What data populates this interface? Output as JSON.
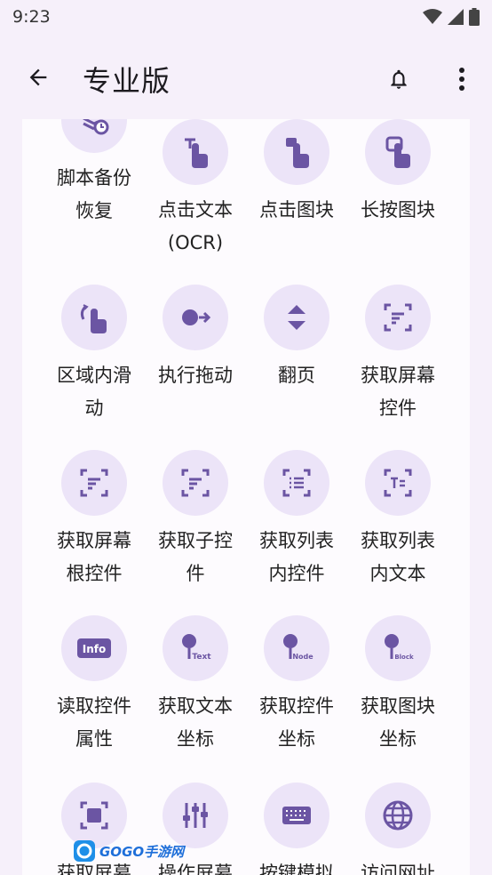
{
  "status": {
    "time": "9:23"
  },
  "appbar": {
    "title": "专业版"
  },
  "tiles": [
    {
      "label": "脚本备份恢复",
      "icon": "backup-restore-icon"
    },
    {
      "label": "点击文本(OCR)",
      "icon": "tap-text-icon"
    },
    {
      "label": "点击图块",
      "icon": "tap-image-icon"
    },
    {
      "label": "长按图块",
      "icon": "long-press-icon"
    },
    {
      "label": "区域内滑动",
      "icon": "swipe-area-icon"
    },
    {
      "label": "执行拖动",
      "icon": "drag-icon"
    },
    {
      "label": "翻页",
      "icon": "page-turn-icon"
    },
    {
      "label": "获取屏幕控件",
      "icon": "screen-widget-icon"
    },
    {
      "label": "获取屏幕根控件",
      "icon": "root-widget-icon"
    },
    {
      "label": "获取子控件",
      "icon": "child-widget-icon"
    },
    {
      "label": "获取列表内控件",
      "icon": "list-widget-icon"
    },
    {
      "label": "获取列表内文本",
      "icon": "list-text-icon"
    },
    {
      "label": "读取控件属性",
      "icon": "info-icon",
      "icon_text": "Info"
    },
    {
      "label": "获取文本坐标",
      "icon": "text-pin-icon",
      "icon_text": "Text"
    },
    {
      "label": "获取控件坐标",
      "icon": "node-pin-icon",
      "icon_text": "Node"
    },
    {
      "label": "获取图块坐标",
      "icon": "block-pin-icon",
      "icon_text": "Block"
    },
    {
      "label": "获取屏幕",
      "icon": "screenshot-icon"
    },
    {
      "label": "操作屏幕",
      "icon": "sliders-icon"
    },
    {
      "label": "按键模拟",
      "icon": "keyboard-icon"
    },
    {
      "label": "访问网址",
      "icon": "globe-icon"
    }
  ],
  "watermark": {
    "text": "GOGO手游网"
  },
  "colors": {
    "accent": "#6b55a3",
    "circle": "#ece4f8",
    "appbar": "#f6f0fa"
  }
}
